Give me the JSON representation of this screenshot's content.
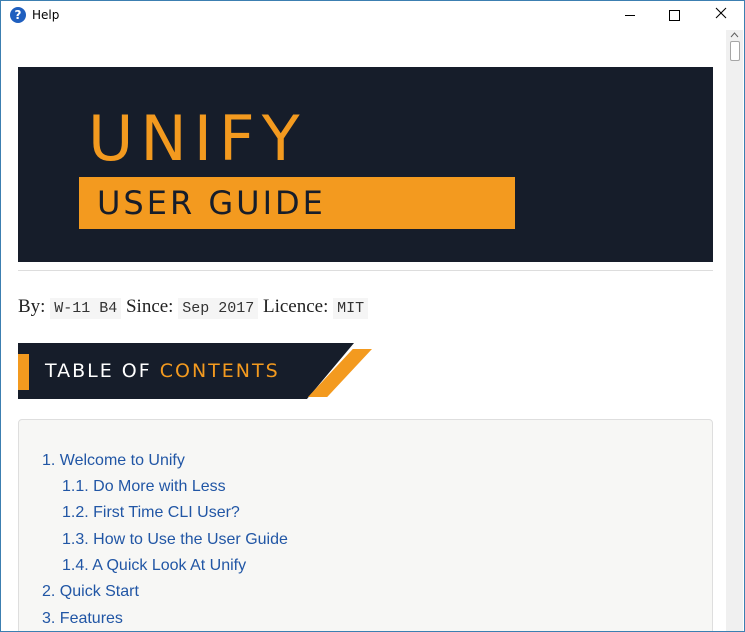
{
  "window": {
    "title": "Help",
    "icon": "help-icon",
    "controls": {
      "minimize": "minimize-icon",
      "maximize": "maximize-icon",
      "close": "close-icon"
    }
  },
  "colors": {
    "banner_bg": "#161d2a",
    "accent": "#f39a1f",
    "link": "#2156a5",
    "toc_bg": "#f7f7f5"
  },
  "banner": {
    "title": "UNIFY",
    "subtitle": "USER GUIDE"
  },
  "byline": {
    "by_label": "By:",
    "by_value": "W-11 B4",
    "since_label": "Since:",
    "since_value": "Sep 2017",
    "licence_label": "Licence:",
    "licence_value": "MIT"
  },
  "toc_banner": {
    "text_white": "TABLE OF ",
    "text_accent": "CONTENTS"
  },
  "toc": {
    "items": [
      {
        "label": "1. Welcome to Unify",
        "level": 1
      },
      {
        "label": "1.1. Do More with Less",
        "level": 2
      },
      {
        "label": "1.2. First Time CLI User?",
        "level": 2
      },
      {
        "label": "1.3. How to Use the User Guide",
        "level": 2
      },
      {
        "label": "1.4. A Quick Look At Unify",
        "level": 2
      },
      {
        "label": "2. Quick Start",
        "level": 1
      },
      {
        "label": "3. Features",
        "level": 1
      }
    ]
  }
}
